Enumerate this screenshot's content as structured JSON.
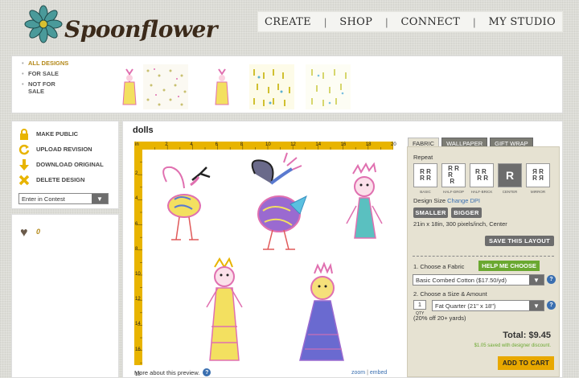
{
  "brand": {
    "name": "Spoonflower"
  },
  "nav": {
    "items": [
      "CREATE",
      "SHOP",
      "CONNECT",
      "MY STUDIO"
    ]
  },
  "designs_filter": {
    "items": [
      "ALL DESIGNS",
      "FOR SALE",
      "NOT FOR SALE"
    ]
  },
  "actions": {
    "make_public": "MAKE PUBLIC",
    "upload_revision": "UPLOAD REVISION",
    "download_original": "DOWNLOAD ORIGINAL",
    "delete_design": "DELETE DESIGN",
    "contest_select": "Enter in Contest"
  },
  "favorites": {
    "count": "0"
  },
  "design": {
    "title": "dolls",
    "preview_note": "More about this preview.",
    "zoom": "zoom",
    "embed": "embed",
    "ruler_unit": "in",
    "ruler_top": [
      "2",
      "4",
      "6",
      "8",
      "10",
      "12",
      "14",
      "16",
      "18",
      "20"
    ],
    "ruler_left": [
      "2",
      "4",
      "6",
      "8",
      "10",
      "12",
      "14",
      "16",
      "18"
    ]
  },
  "tabs": {
    "items": [
      "FABRIC",
      "WALLPAPER",
      "GIFT WRAP"
    ],
    "active": "FABRIC"
  },
  "options": {
    "repeat_label": "Repeat",
    "repeat_types": [
      "BASIC",
      "HALF-DROP",
      "HALF-BRICK",
      "CENTER",
      "MIRROR"
    ],
    "repeat_active": "CENTER",
    "design_size_label": "Design Size",
    "change_dpi": "Change DPI",
    "smaller": "SMALLER",
    "bigger": "BIGGER",
    "size_info": "21in x 18in, 300 pixels/inch, Center",
    "save_layout": "SAVE THIS LAYOUT",
    "choose_fabric_label": "1. Choose a Fabric",
    "help_me_choose": "HELP ME CHOOSE",
    "fabric_value": "Basic Combed Cotton ($17.50/yd)",
    "choose_size_label": "2. Choose a Size & Amount",
    "qty_value": "1",
    "qty_label": "QTY",
    "size_value": "Fat Quarter (21\" x 18\")",
    "discount_note": "(20% off 20+ yards)",
    "total": "Total: $9.45",
    "saved_note": "$1.05 saved with designer discount.",
    "add_to_cart": "ADD TO CART"
  },
  "colors": {
    "accent": "#e8b400",
    "button": "#6d6d6d",
    "green": "#6aa830",
    "link": "#3a6fb0"
  }
}
